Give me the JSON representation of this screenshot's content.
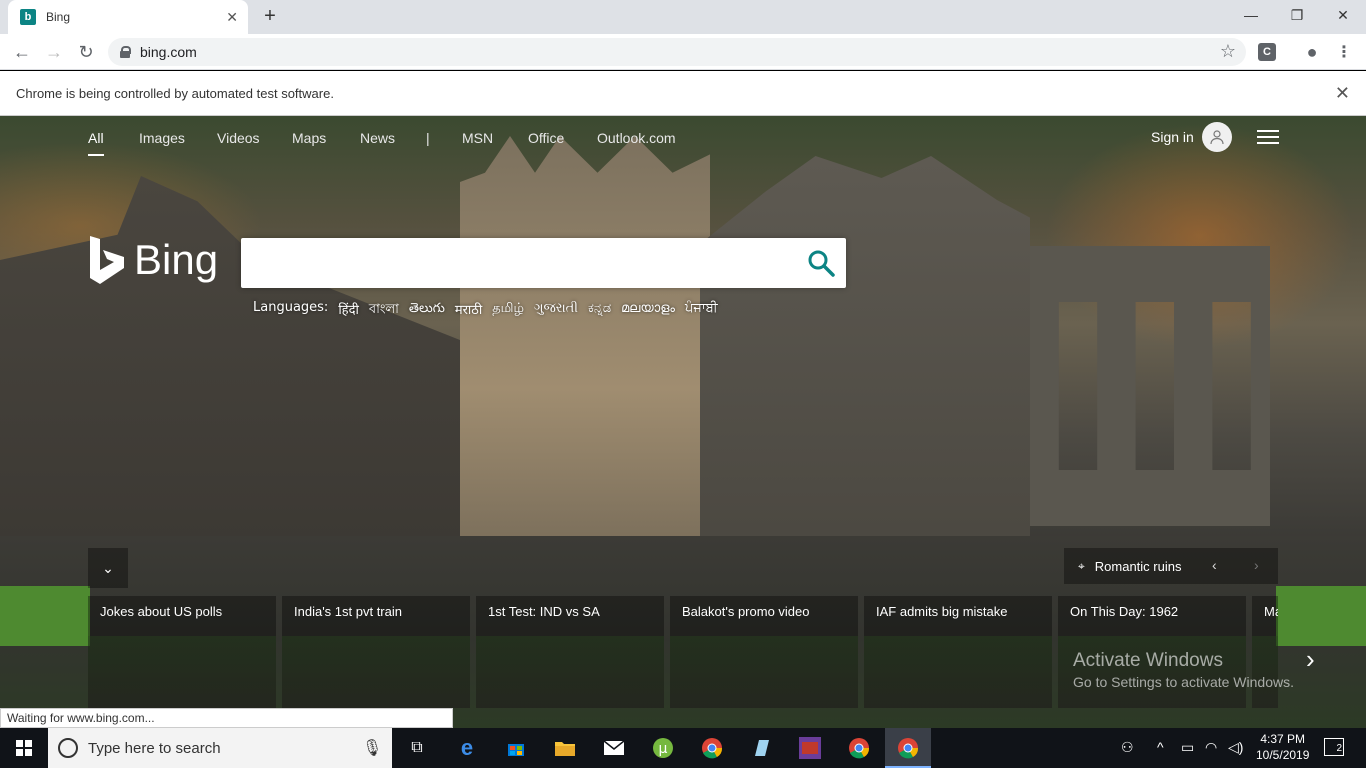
{
  "browser": {
    "tab_title": "Bing",
    "url": "bing.com",
    "infobar_text": "Chrome is being controlled by automated test software."
  },
  "bing": {
    "nav": [
      "All",
      "Images",
      "Videos",
      "Maps",
      "News",
      "|",
      "MSN",
      "Office",
      "Outlook.com"
    ],
    "sign_in": "Sign in",
    "logo_text": "Bing",
    "search_placeholder": "",
    "languages_label": "Languages:",
    "languages": [
      "हिंदी",
      "বাংলা",
      "తెలుగు",
      "मराठी",
      "தமிழ்",
      "ગુજરાતી",
      "ಕನ್ನಡ",
      "മലയാളം",
      "ਪੰਜਾਬੀ"
    ],
    "image_caption": "Romantic ruins",
    "news_cards": [
      "Jokes about US polls",
      "India's 1st pvt train",
      "1st Test: IND vs SA",
      "Balakot's promo video",
      "IAF admits big mistake",
      "On This Day: 1962",
      "Ma"
    ]
  },
  "watermark": {
    "line1": "Activate Windows",
    "line2": "Go to Settings to activate Windows."
  },
  "status_text": "Waiting for www.bing.com...",
  "taskbar": {
    "search_placeholder": "Type here to search",
    "time": "4:37 PM",
    "date": "10/5/2019",
    "notification_count": "2"
  },
  "colors": {
    "bing_accent": "#0c8484",
    "taskbar_bg": "#101318"
  }
}
